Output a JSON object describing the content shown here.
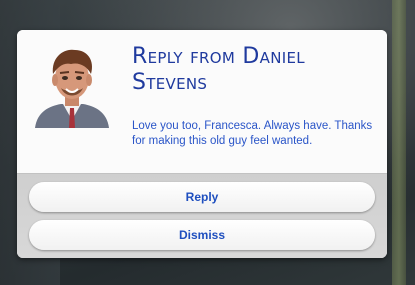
{
  "dialog": {
    "title": "Reply from Daniel Stevens",
    "message": "Love you too, Francesca. Always have. Thanks for making this old guy feel wanted.",
    "portrait_icon": "sim-portrait-daniel-stevens"
  },
  "buttons": {
    "reply_label": "Reply",
    "dismiss_label": "Dismiss"
  },
  "colors": {
    "title": "#1f3a9e",
    "message": "#2a55c8",
    "button_text": "#1f4fbf"
  }
}
